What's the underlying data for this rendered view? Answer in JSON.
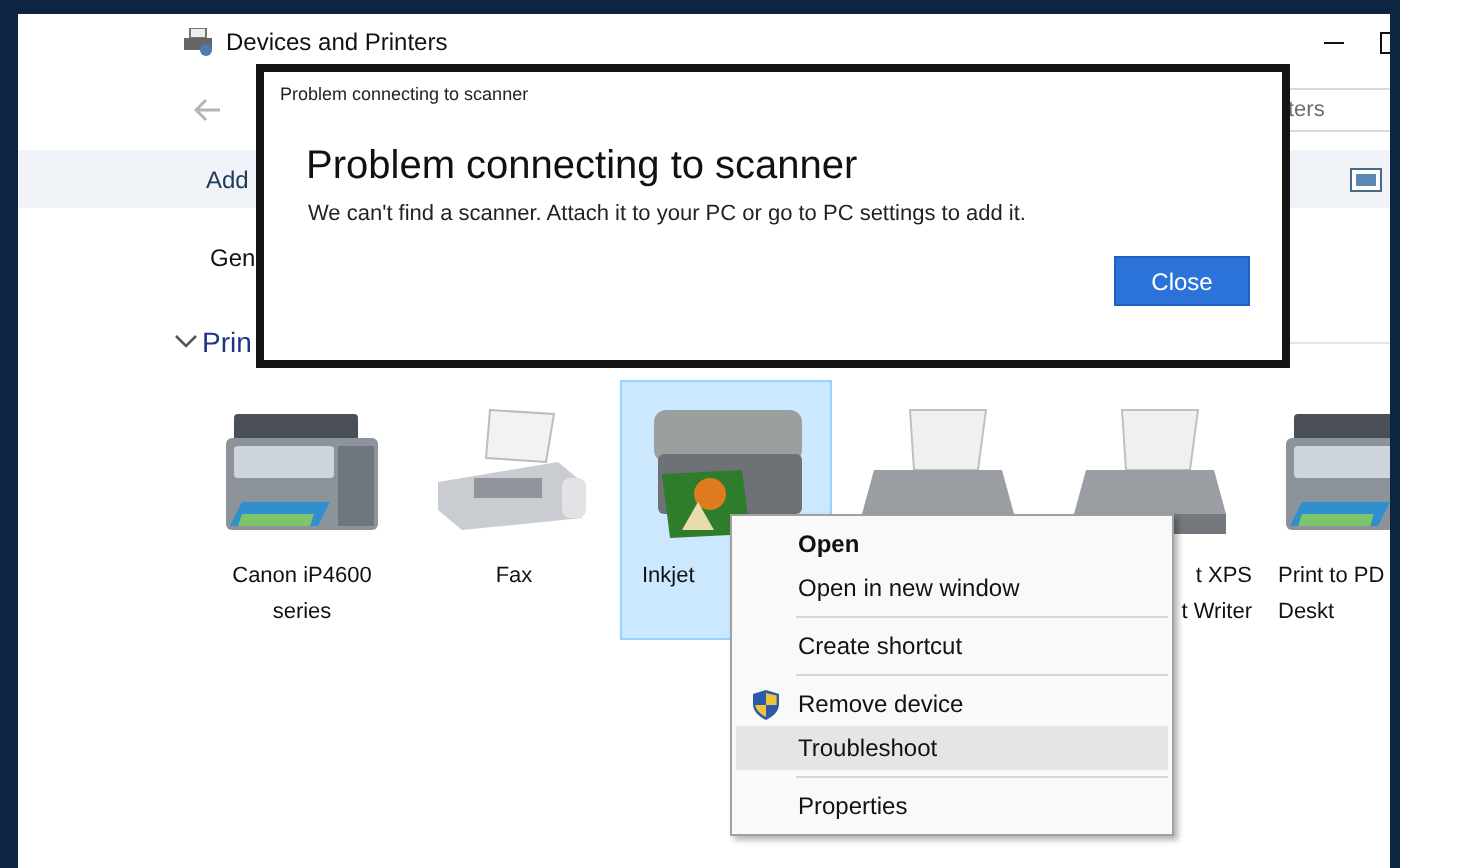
{
  "window": {
    "title": "Devices and Printers"
  },
  "search": {
    "placeholder": "ters"
  },
  "command_bar": {
    "items": [
      "Add"
    ]
  },
  "details_row": {
    "text": "Gen"
  },
  "section": {
    "title": "Prin",
    "expanded": true
  },
  "devices": [
    {
      "kind": "mfp",
      "label": [
        "Canon iP4600",
        "series"
      ],
      "selected": false
    },
    {
      "kind": "fax",
      "label": [
        "Fax"
      ],
      "selected": false
    },
    {
      "kind": "scanner",
      "label": [
        "Inkjet"
      ],
      "selected": true
    },
    {
      "kind": "printer",
      "selected": false
    },
    {
      "kind": "printer",
      "label": [
        "t XPS",
        "t Writer"
      ],
      "selected": false
    },
    {
      "kind": "mfp",
      "label": [
        "Print to PD",
        "Deskt"
      ],
      "selected": false
    }
  ],
  "dialog": {
    "title": "Problem connecting to scanner",
    "heading": "Problem connecting to scanner",
    "message": "We can't find a scanner. Attach it to your PC or go to PC settings to add it.",
    "button": "Close"
  },
  "context_menu": {
    "items": [
      {
        "kind": "item",
        "label": "Open",
        "default": true,
        "elevated": false,
        "selected": false
      },
      {
        "kind": "item",
        "label": "Open in new window",
        "default": false,
        "elevated": false,
        "selected": false
      },
      {
        "kind": "separator"
      },
      {
        "kind": "item",
        "label": "Create shortcut",
        "default": false,
        "elevated": false,
        "selected": false
      },
      {
        "kind": "separator"
      },
      {
        "kind": "item",
        "label": "Remove device",
        "default": false,
        "elevated": true,
        "selected": false
      },
      {
        "kind": "item",
        "label": "Troubleshoot",
        "default": false,
        "elevated": false,
        "selected": true
      },
      {
        "kind": "separator"
      },
      {
        "kind": "item",
        "label": "Properties",
        "default": false,
        "elevated": false,
        "selected": false
      }
    ]
  }
}
